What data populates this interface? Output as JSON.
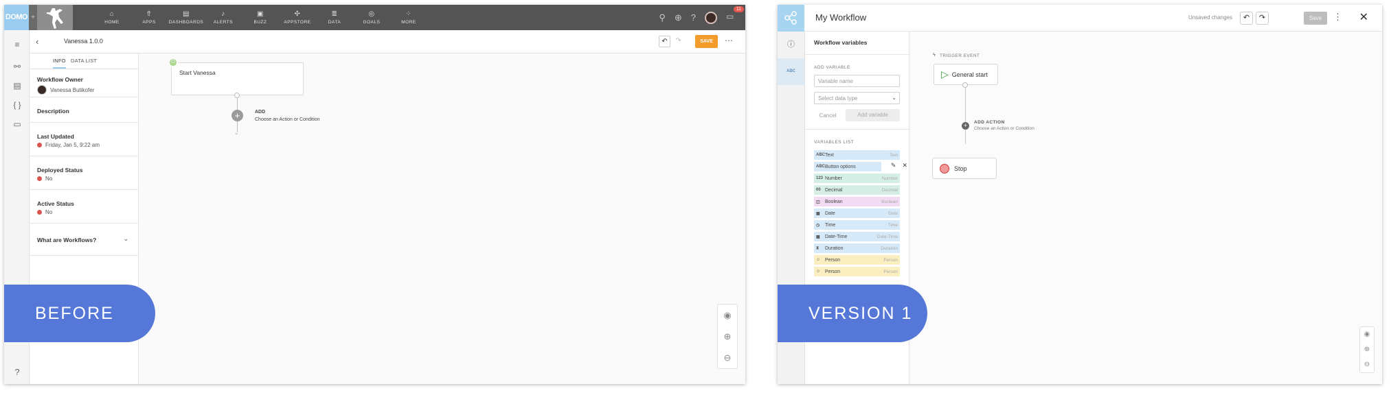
{
  "before": {
    "logo": "DOMO",
    "nav": [
      "HOME",
      "APPS",
      "DASHBOARDS",
      "ALERTS",
      "BUZZ",
      "APPSTORE",
      "DATA",
      "GOALS",
      "MORE"
    ],
    "notif_count": "11",
    "workflow_name": "Vanessa 1.0.0",
    "save_label": "SAVE",
    "tabs": [
      "INFO",
      "DATA LIST"
    ],
    "owner_heading": "Workflow Owner",
    "owner_name": "Vanessa Butikofer",
    "description": "Description",
    "last_updated_heading": "Last Updated",
    "last_updated_value": "Friday, Jan 5, 9:22 am",
    "deployed_heading": "Deployed Status",
    "deployed_value": "No",
    "active_heading": "Active Status",
    "active_value": "No",
    "what_are": "What are Workflows?",
    "start_node": "Start Vanessa",
    "add_heading": "ADD",
    "add_sub": "Choose an Action or Condition",
    "label": "BEFORE",
    "help": "?"
  },
  "version1": {
    "title": "My Workflow",
    "unsaved": "Unsaved changes",
    "save_label": "Save",
    "side_tab": "ABC",
    "panel_title": "Workflow variables",
    "add_variable_label": "ADD VARIABLE",
    "name_placeholder": "Variable name",
    "type_placeholder": "Select data type",
    "cancel": "Cancel",
    "add_button": "Add variable",
    "list_label": "VARIABLES LIST",
    "variables": [
      {
        "icon": "ABC",
        "name": "Text",
        "type": "Text",
        "color": "#d6e9f8"
      },
      {
        "icon": "ABC",
        "name": "Button options",
        "type": "",
        "color": "#d6e9f8"
      },
      {
        "icon": "123",
        "name": "Number",
        "type": "Number",
        "color": "#d5efe6"
      },
      {
        "icon": "00",
        "name": "Decimal",
        "type": "Decimal",
        "color": "#d5efe6"
      },
      {
        "icon": "◫",
        "name": "Boolean",
        "type": "Boolean",
        "color": "#f3dcf3"
      },
      {
        "icon": "▦",
        "name": "Date",
        "type": "Date",
        "color": "#d6e9f8"
      },
      {
        "icon": "◷",
        "name": "Time",
        "type": "Time",
        "color": "#d6e9f8"
      },
      {
        "icon": "▦",
        "name": "Date-Time",
        "type": "Date-Time",
        "color": "#d6e9f8"
      },
      {
        "icon": "⧗",
        "name": "Duration",
        "type": "Duration",
        "color": "#d6e9f8"
      },
      {
        "icon": "☺",
        "name": "Person",
        "type": "Person",
        "color": "#fbeec0"
      },
      {
        "icon": "☺",
        "name": "Person",
        "type": "Person",
        "color": "#fbeec0"
      }
    ],
    "trigger_label": "TRIGGER EVENT",
    "start_node": "General start",
    "add_action": "ADD ACTION",
    "add_action_sub": "Choose an Action or Condition",
    "stop_node": "Stop",
    "label": "VERSION 1"
  }
}
